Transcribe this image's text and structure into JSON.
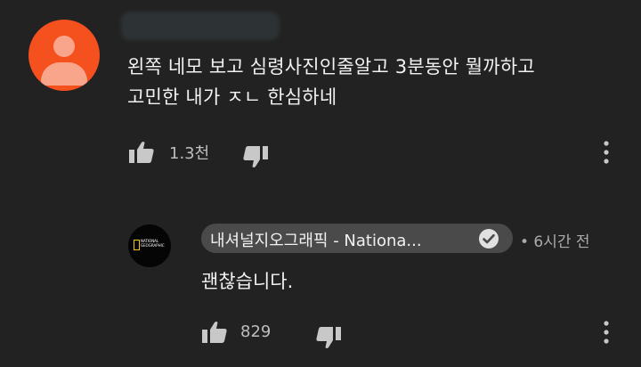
{
  "top_comment": {
    "avatar_icon": "default-user-avatar",
    "accent_color": "#f4511e",
    "text_line1": "왼쪽 네모 보고 심령사진인줄알고 3분동안 뭘까하고",
    "text_line2": "고민한 내가 ㅈㄴ 한심하네",
    "like_count": "1.3천"
  },
  "reply": {
    "avatar_icon": "national-geographic-logo",
    "avatar_text": "NATIONAL GEOGRAPHIC",
    "channel_name": "내셔널지오그래픽 - Nationa...",
    "verified_icon": "verified-check-icon",
    "time": "• 6시간 전",
    "text": "괜찮습니다.",
    "like_count": "829"
  }
}
